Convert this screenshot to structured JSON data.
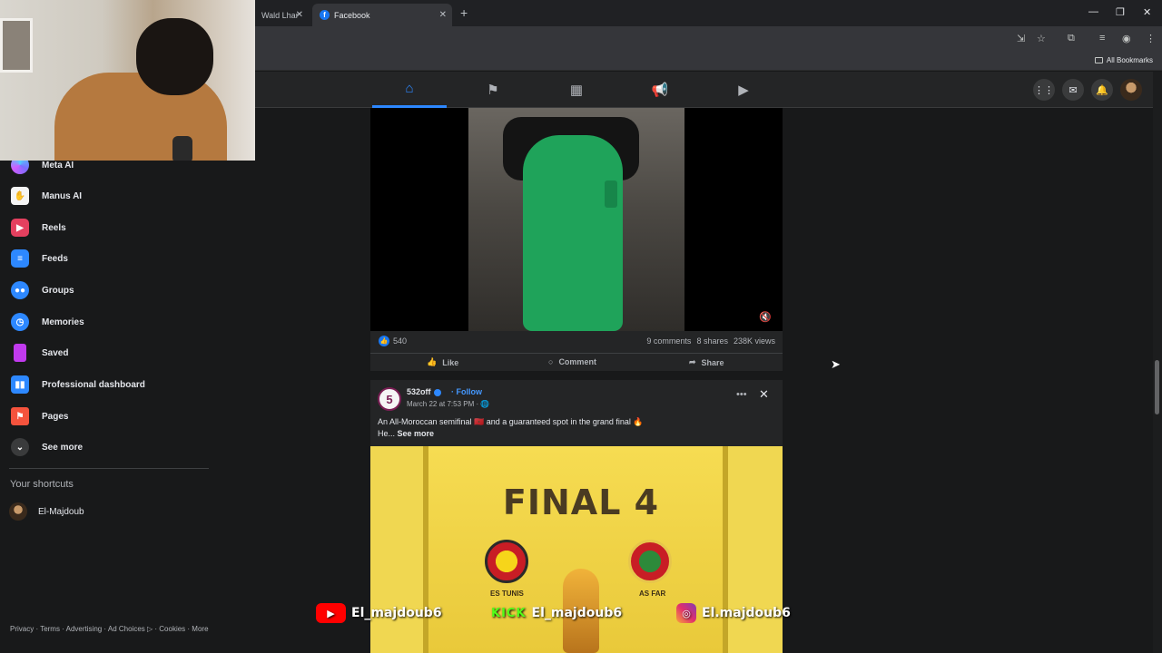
{
  "browser": {
    "tabs": [
      {
        "title": "Wald Lhar",
        "active": false
      },
      {
        "title": "Facebook",
        "active": true
      }
    ],
    "new_tab": "+",
    "window_controls": {
      "minimize": "—",
      "restore": "❐",
      "close": "✕"
    },
    "bookmarks_label": "All Bookmarks"
  },
  "fb_nav": {
    "icons": [
      "home-icon",
      "flag-icon",
      "chart-icon",
      "megaphone-icon",
      "video-icon"
    ],
    "right_icons": [
      "grid-menu-icon",
      "messenger-icon",
      "bell-icon"
    ]
  },
  "sidebar": {
    "items": [
      {
        "label": "Meta AI",
        "icon": "meta-ai-icon",
        "color": "#7b6cff"
      },
      {
        "label": "Manus AI",
        "icon": "manus-ai-icon",
        "color": "#f5f5f5"
      },
      {
        "label": "Reels",
        "icon": "reels-icon",
        "color": "#e4405f"
      },
      {
        "label": "Feeds",
        "icon": "feeds-icon",
        "color": "#2d88ff"
      },
      {
        "label": "Groups",
        "icon": "groups-icon",
        "color": "#2d88ff"
      },
      {
        "label": "Memories",
        "icon": "memories-icon",
        "color": "#2d88ff"
      },
      {
        "label": "Saved",
        "icon": "saved-icon",
        "color": "#c13aee"
      },
      {
        "label": "Professional dashboard",
        "icon": "dashboard-icon",
        "color": "#2d88ff"
      },
      {
        "label": "Pages",
        "icon": "pages-icon",
        "color": "#f5533d"
      },
      {
        "label": "See more",
        "icon": "chevron-down-icon",
        "color": "#3a3b3c"
      }
    ],
    "shortcuts_title": "Your shortcuts",
    "shortcuts": [
      {
        "label": "El-Majdoub",
        "icon": "avatar"
      }
    ],
    "footer": "Privacy · Terms · Advertising · Ad Choices ▷ · Cookies · More"
  },
  "video_post": {
    "likes": "540",
    "comments": "9 comments",
    "shares": "8 shares",
    "views": "238K views",
    "actions": {
      "like": "Like",
      "comment": "Comment",
      "share": "Share"
    }
  },
  "post2": {
    "author": "532off",
    "follow": "· Follow",
    "date": "March 22 at 7:53 PM · 🌐",
    "avatar_text": "5",
    "text": "An All-Moroccan semifinal 🇲🇦 and a guaranteed spot in the grand final 🔥",
    "text_line2": "He...",
    "see_more": "See more",
    "poster": {
      "title": "FINAL 4",
      "team_left": "ES TUNIS",
      "team_right": "AS FAR"
    }
  },
  "overlays": {
    "youtube": "El_majdoub6",
    "kick_logo": "KICK",
    "kick": "El_majdoub6",
    "instagram": "El.majdoub6"
  }
}
